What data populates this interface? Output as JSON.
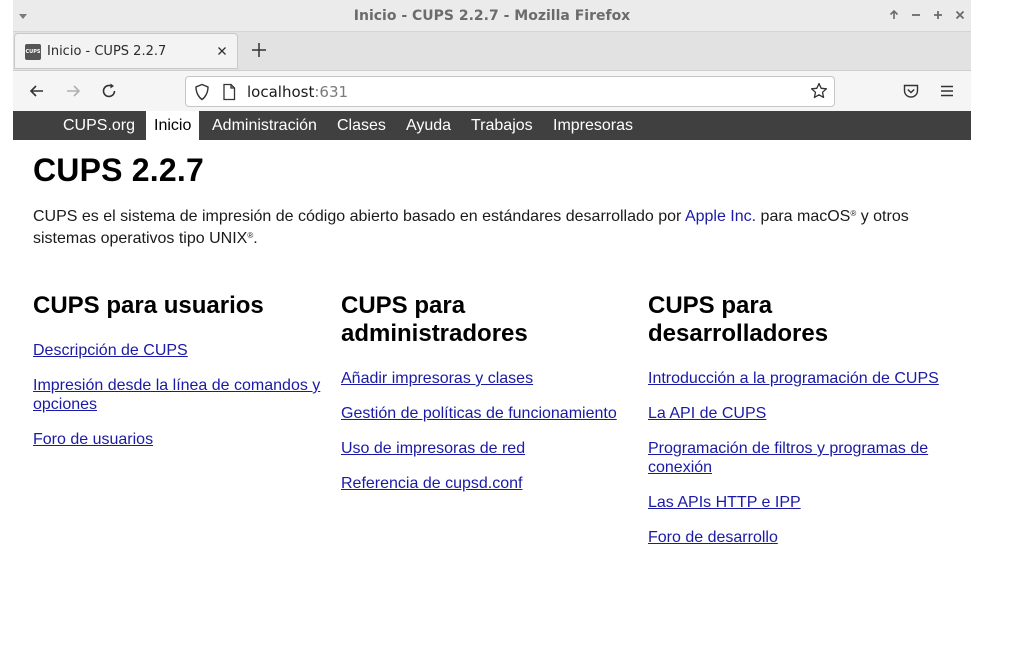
{
  "window": {
    "title": "Inicio - CUPS 2.2.7 - Mozilla Firefox"
  },
  "tab": {
    "favicon_text": "CUPS",
    "label": "Inicio - CUPS 2.2.7"
  },
  "urlbar": {
    "host": "localhost",
    "port": ":631"
  },
  "cups_nav": {
    "items": [
      "CUPS.org",
      "Inicio",
      "Administración",
      "Clases",
      "Ayuda",
      "Trabajos",
      "Impresoras"
    ],
    "active": "Inicio"
  },
  "content": {
    "heading": "CUPS 2.2.7",
    "intro_before": "CUPS es el sistema de impresión de código abierto basado en estándares desarrollado por ",
    "intro_link": "Apple Inc.",
    "intro_mid": " para macOS",
    "intro_reg1": "®",
    "intro_mid2": " y otros sistemas operativos tipo UNIX",
    "intro_reg2": "®",
    "intro_end": ".",
    "columns": [
      {
        "title": "CUPS para usuarios",
        "links": [
          "Descripción de CUPS",
          "Impresión desde la línea de comandos y opciones",
          "Foro de usuarios"
        ]
      },
      {
        "title": "CUPS para administradores",
        "links": [
          "Añadir impresoras y clases",
          "Gestión de políticas de funcionamiento",
          "Uso de impresoras de red",
          "Referencia de cupsd.conf"
        ]
      },
      {
        "title": "CUPS para desarrolladores",
        "links": [
          "Introducción a la programación de CUPS",
          "La API de CUPS",
          "Programación de filtros y programas de conexión",
          "Las APIs HTTP e IPP",
          "Foro de desarrollo"
        ]
      }
    ]
  }
}
